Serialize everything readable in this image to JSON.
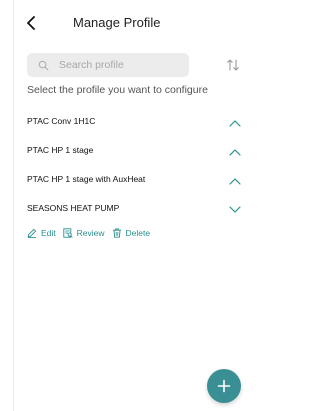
{
  "header": {
    "title": "Manage Profile",
    "back_icon": "chevron-left-icon"
  },
  "search": {
    "placeholder": "Search profile",
    "value": "",
    "icon": "search-icon",
    "sort_icon": "sort-arrows-icon"
  },
  "instruction": "Select the profile you want to configure",
  "profiles": [
    {
      "name": "PTAC Conv 1H1C",
      "expanded": false,
      "chevron": "chevron-up-icon"
    },
    {
      "name": "PTAC HP 1 stage",
      "expanded": false,
      "chevron": "chevron-up-icon"
    },
    {
      "name": "PTAC HP 1 stage with AuxHeat",
      "expanded": false,
      "chevron": "chevron-up-icon"
    },
    {
      "name": "SEASONS HEAT PUMP",
      "expanded": true,
      "chevron": "chevron-down-icon"
    }
  ],
  "actions": {
    "edit": "Edit",
    "review": "Review",
    "delete": "Delete"
  },
  "colors": {
    "accent": "#2a8f8f",
    "fab": "#3a8f95",
    "search_bg": "#ececec"
  },
  "fab": {
    "icon": "plus-icon"
  }
}
